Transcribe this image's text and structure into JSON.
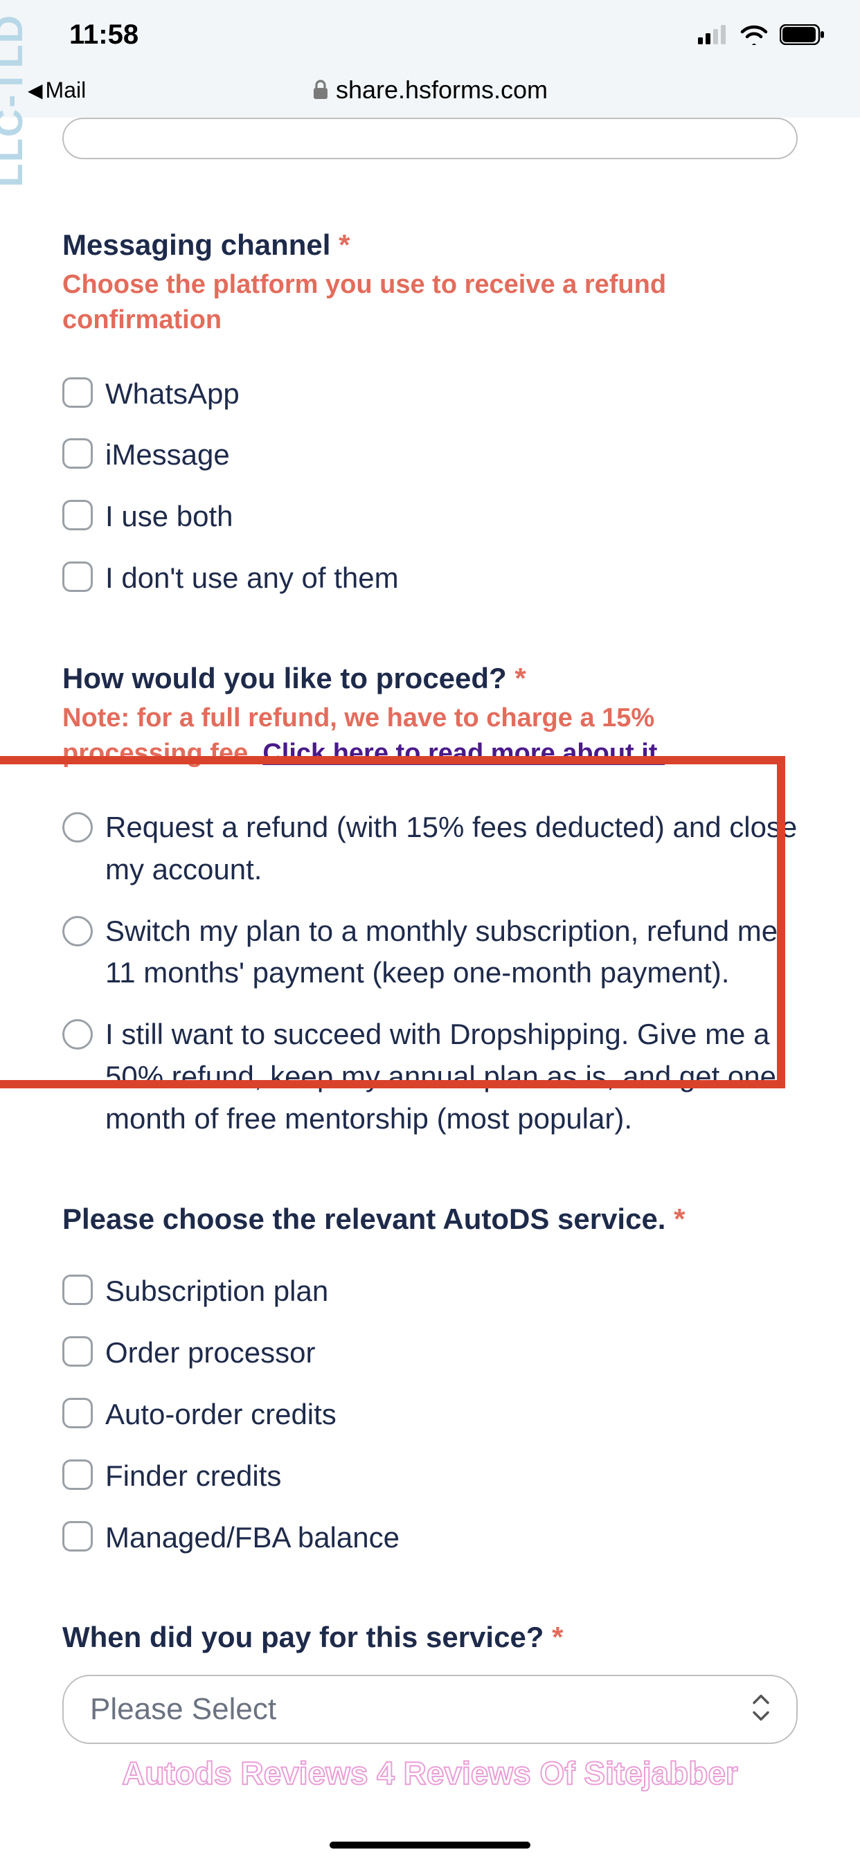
{
  "statusBar": {
    "time": "11:58",
    "backLabel": "Mail",
    "url": "share.hsforms.com"
  },
  "watermarkLeft": "LLC-TLD",
  "q1": {
    "label": "Messaging channel",
    "hint": "Choose the platform you use to receive a refund confirmation",
    "options": [
      "WhatsApp",
      "iMessage",
      "I use both",
      "I don't use any of them"
    ]
  },
  "q2": {
    "label": "How would you like to proceed?",
    "hintPrefix": "Note: for a full refund, we have to charge a 15% processing fee.",
    "hintLink": "Click here to read more about it.",
    "options": [
      "Request a refund (with 15% fees deducted) and close my account.",
      "Switch my plan to a monthly subscription, refund me 11 months' payment (keep one-month payment).",
      "I still want to succeed with Dropshipping. Give me a 50% refund, keep my annual plan as is, and get one month of free mentorship (most popular)."
    ]
  },
  "q3": {
    "label": "Please choose the relevant AutoDS service.",
    "options": [
      "Subscription plan",
      "Order processor",
      "Auto-order credits",
      "Finder credits",
      "Managed/FBA balance"
    ]
  },
  "q4": {
    "label": "When did you pay for this service?",
    "placeholder": "Please Select"
  },
  "bottomWatermark": "Autods Reviews 4 Reviews Of Sitejabber"
}
